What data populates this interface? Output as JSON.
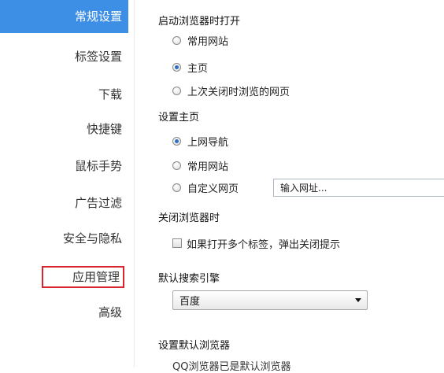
{
  "sidebar": {
    "items": [
      {
        "label": "常规设置"
      },
      {
        "label": "标签设置"
      },
      {
        "label": "下载"
      },
      {
        "label": "快捷键"
      },
      {
        "label": "鼠标手势"
      },
      {
        "label": "广告过滤"
      },
      {
        "label": "安全与隐私"
      },
      {
        "label": "应用管理"
      },
      {
        "label": "高级"
      }
    ]
  },
  "startup": {
    "title": "启动浏览器时打开",
    "options": [
      {
        "label": "常用网站",
        "selected": false
      },
      {
        "label": "主页",
        "selected": true
      },
      {
        "label": "上次关闭时浏览的网页",
        "selected": false
      }
    ]
  },
  "homepage": {
    "title": "设置主页",
    "options": [
      {
        "label": "上网导航",
        "selected": true
      },
      {
        "label": "常用网站",
        "selected": false
      },
      {
        "label": "自定义网页",
        "selected": false
      }
    ],
    "custom_url_placeholder": "输入网址..."
  },
  "close_browser": {
    "title": "关闭浏览器时",
    "checkbox_label": "如果打开多个标签，弹出关闭提示",
    "checked": false
  },
  "search_engine": {
    "title": "默认搜索引擎",
    "selected": "百度"
  },
  "default_browser": {
    "title": "设置默认浏览器",
    "status": "QQ浏览器已是默认浏览器"
  }
}
